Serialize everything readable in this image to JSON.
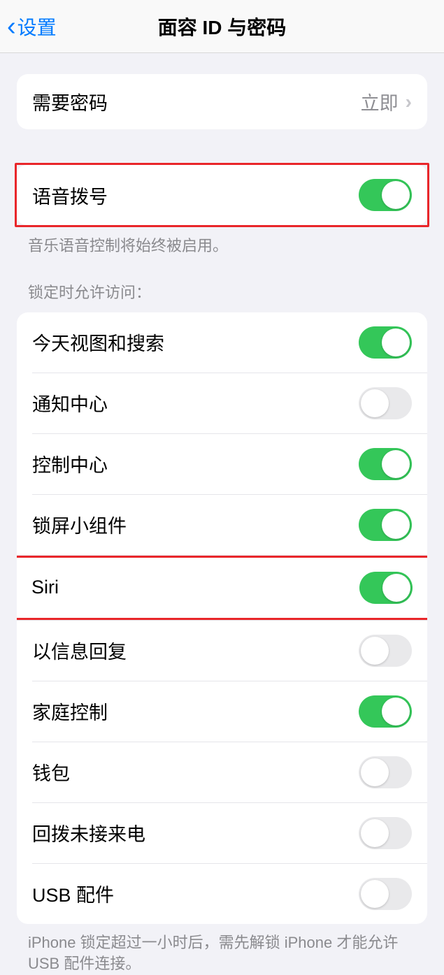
{
  "header": {
    "back_label": "设置",
    "title": "面容 ID 与密码"
  },
  "group1": {
    "require_passcode_label": "需要密码",
    "require_passcode_value": "立即"
  },
  "group2": {
    "voice_dial_label": "语音拨号",
    "voice_dial_on": true,
    "footer": "音乐语音控制将始终被启用。"
  },
  "group3": {
    "header": "锁定时允许访问：",
    "items": [
      {
        "label": "今天视图和搜索",
        "on": true
      },
      {
        "label": "通知中心",
        "on": false
      },
      {
        "label": "控制中心",
        "on": true
      },
      {
        "label": "锁屏小组件",
        "on": true
      },
      {
        "label": "Siri",
        "on": true
      },
      {
        "label": "以信息回复",
        "on": false
      },
      {
        "label": "家庭控制",
        "on": true
      },
      {
        "label": "钱包",
        "on": false
      },
      {
        "label": "回拨未接来电",
        "on": false
      },
      {
        "label": "USB 配件",
        "on": false
      }
    ],
    "footer": "iPhone 锁定超过一小时后，需先解锁 iPhone 才能允许USB 配件连接。"
  }
}
